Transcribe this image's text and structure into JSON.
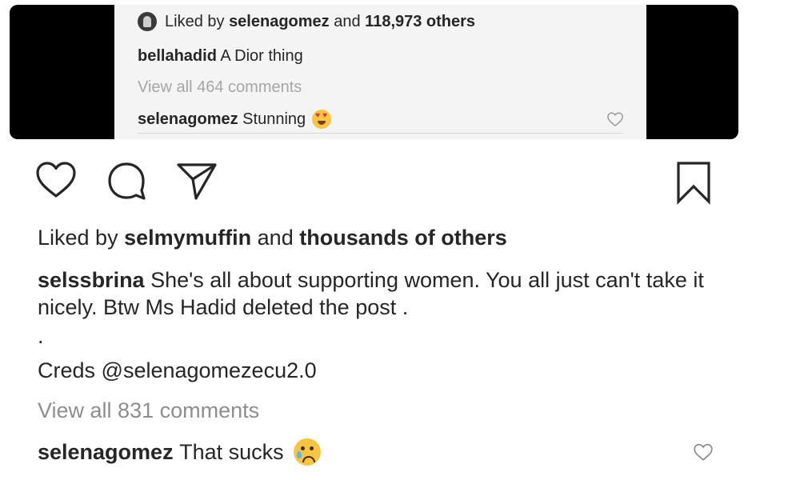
{
  "embedded_post": {
    "liked_by_prefix": "Liked by",
    "liked_by_user": "selenagomez",
    "liked_by_suffix": "and",
    "liked_by_count": "118,973 others",
    "caption_user": "bellahadid",
    "caption_text": "A Dior thing",
    "view_all_comments": "View all 464 comments",
    "comment_user": "selenagomez",
    "comment_text": "Stunning",
    "comment_emoji": "heart-eyes-emoji"
  },
  "action_bar": {
    "icons": [
      "heart-icon",
      "comment-icon",
      "share-icon",
      "bookmark-icon"
    ]
  },
  "post": {
    "likes_prefix": "Liked by",
    "likes_user": "selmymuffin",
    "likes_middle": "and",
    "likes_rest": "thousands of others",
    "caption_user": "selssbrina",
    "caption_text": "She's all about supporting women. You all just can't take it nicely. Btw Ms Hadid deleted the post .",
    "dot": ".",
    "creds_label": "Creds",
    "creds_handle": "@selenagomezecu2.0",
    "view_all_comments": "View all 831 comments",
    "comment_user": "selenagomez",
    "comment_text": "That sucks",
    "comment_emoji": "crying-face-emoji"
  },
  "colors": {
    "text": "#262626",
    "muted": "#8e8e8e",
    "panel_bg": "#000000",
    "inner_bg": "#f4f4f4"
  }
}
